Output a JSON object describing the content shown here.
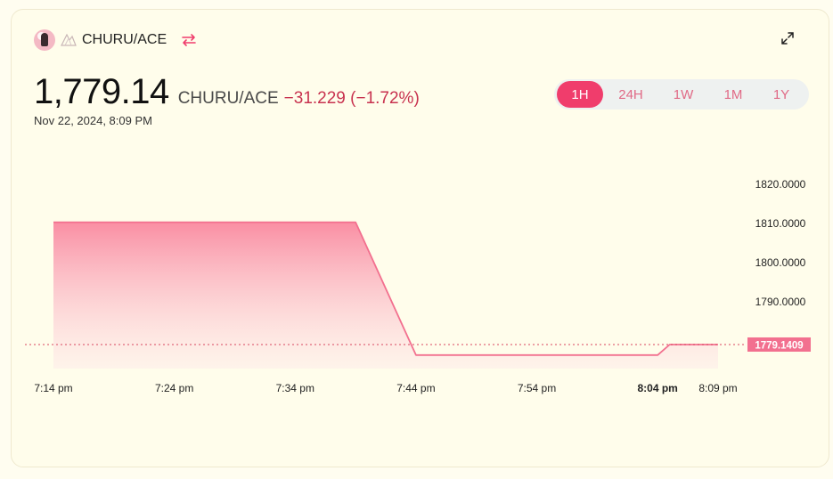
{
  "header": {
    "pair_label": "CHURU/ACE",
    "token_icon": "churu-token-icon",
    "secondary_icon": "ace-token-icon",
    "swap_icon": "swap-arrows-icon",
    "expand_icon": "expand-icon"
  },
  "price": {
    "value": "1,779.14",
    "pair": "CHURU/ACE",
    "change": "−31.229 (−1.72%)",
    "timestamp": "Nov 22, 2024, 8:09 PM"
  },
  "range_tabs": [
    {
      "label": "1H",
      "active": true
    },
    {
      "label": "24H",
      "active": false
    },
    {
      "label": "1W",
      "active": false
    },
    {
      "label": "1M",
      "active": false
    },
    {
      "label": "1Y",
      "active": false
    }
  ],
  "colors": {
    "accent": "#f03d6c",
    "line": "#f2708f",
    "negative": "#c8324f"
  },
  "chart_data": {
    "type": "area",
    "x": [
      "7:14 pm",
      "7:24 pm",
      "7:34 pm",
      "7:39 pm",
      "7:44 pm",
      "7:54 pm",
      "8:04 pm",
      "8:05 pm",
      "8:09 pm"
    ],
    "x_minutes": [
      0,
      10,
      20,
      25,
      30,
      40,
      50,
      51,
      55
    ],
    "values": [
      1810.37,
      1810.37,
      1810.37,
      1810.37,
      1776.45,
      1776.45,
      1776.45,
      1779.14,
      1779.14
    ],
    "x_ticks": [
      {
        "label": "7:14 pm",
        "minute": 0,
        "bold": false
      },
      {
        "label": "7:24 pm",
        "minute": 10,
        "bold": false
      },
      {
        "label": "7:34 pm",
        "minute": 20,
        "bold": false
      },
      {
        "label": "7:44 pm",
        "minute": 30,
        "bold": false
      },
      {
        "label": "7:54 pm",
        "minute": 40,
        "bold": false
      },
      {
        "label": "8:04 pm",
        "minute": 50,
        "bold": true
      },
      {
        "label": "8:09 pm",
        "minute": 55,
        "bold": false
      }
    ],
    "y_ticks": [
      "1820.0000",
      "1810.0000",
      "1800.0000",
      "1790.0000"
    ],
    "y_tick_values": [
      1820,
      1810,
      1800,
      1790
    ],
    "current_value": 1779.1409,
    "current_label": "1779.1409",
    "ylim": [
      1773,
      1833
    ],
    "grid": false
  }
}
